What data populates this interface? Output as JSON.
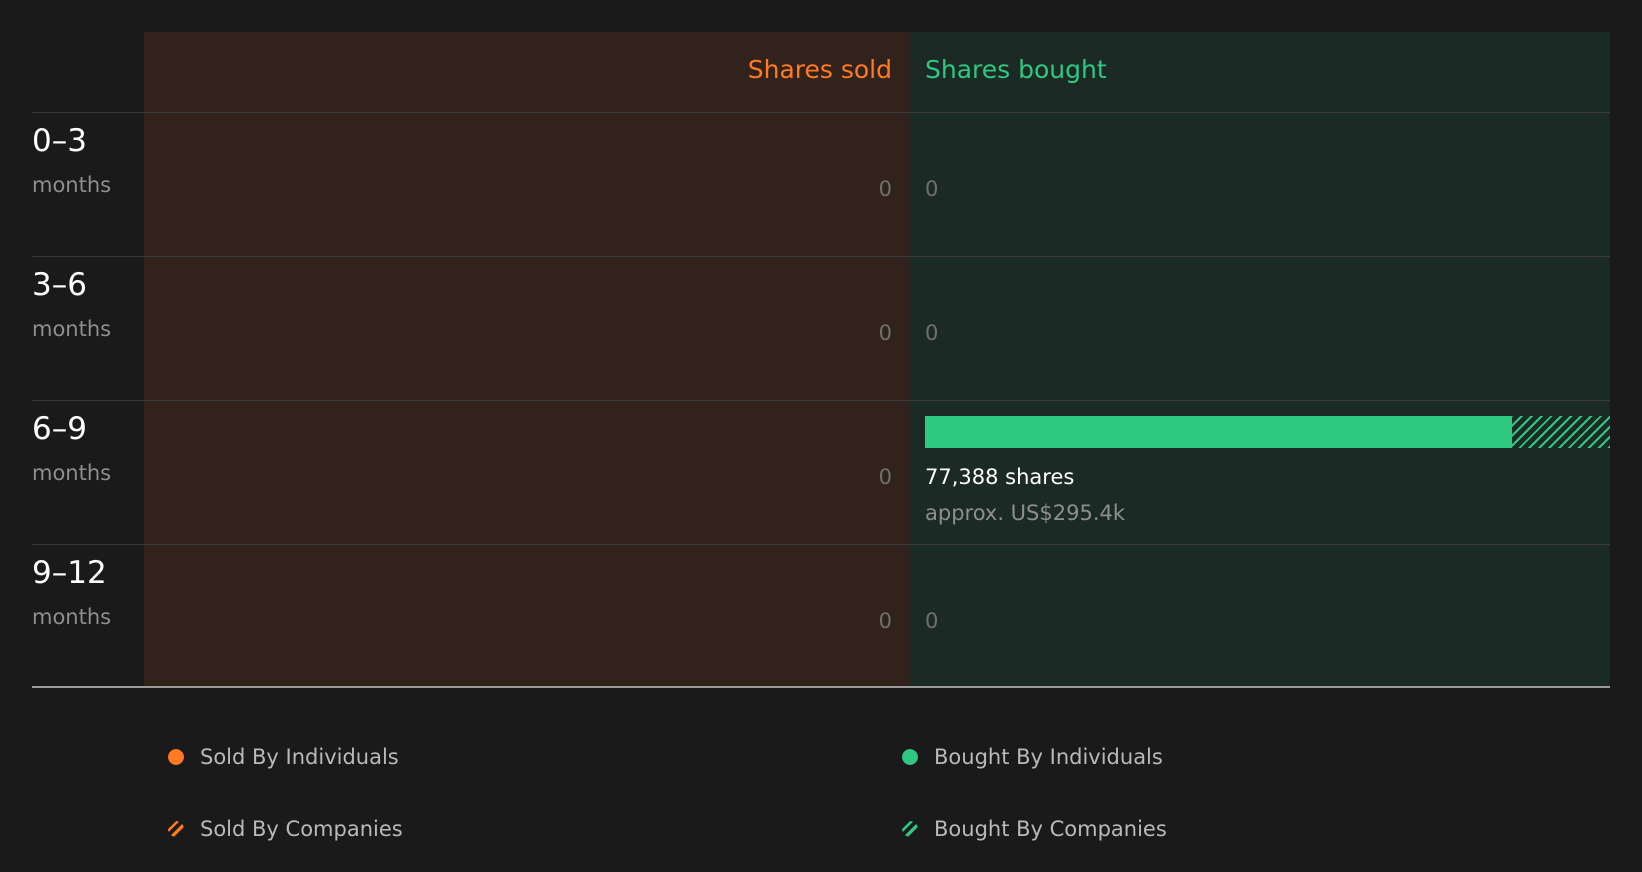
{
  "colors": {
    "sold": "#ff7a22",
    "bought": "#2ec880",
    "sold_panel": "#31231c",
    "bought_panel": "#1b2a24"
  },
  "chart_data": {
    "type": "bar",
    "orientation": "horizontal-diverging",
    "column_headers": {
      "sold": "Shares sold",
      "bought": "Shares bought"
    },
    "categories": [
      {
        "range": "0–3",
        "unit": "months"
      },
      {
        "range": "3–6",
        "unit": "months"
      },
      {
        "range": "6–9",
        "unit": "months"
      },
      {
        "range": "9–12",
        "unit": "months"
      }
    ],
    "series": [
      {
        "name": "Sold By Individuals",
        "side": "sold",
        "pattern": "solid",
        "values": [
          0,
          0,
          0,
          0
        ]
      },
      {
        "name": "Sold By Companies",
        "side": "sold",
        "pattern": "hatched",
        "values": [
          0,
          0,
          0,
          0
        ]
      },
      {
        "name": "Bought By Individuals",
        "side": "bought",
        "pattern": "solid",
        "values": [
          0,
          0,
          66300,
          0
        ]
      },
      {
        "name": "Bought By Companies",
        "side": "bought",
        "pattern": "hatched",
        "values": [
          0,
          0,
          11088,
          0
        ]
      }
    ],
    "row_labels": {
      "sold": [
        "0",
        "0",
        "0",
        "0"
      ],
      "bought": [
        "0",
        "0",
        null,
        "0"
      ]
    },
    "totals": {
      "bought_6_9_shares": "77,388 shares",
      "bought_6_9_value": "approx. US$295.4k"
    },
    "legend": [
      {
        "label": "Sold By Individuals",
        "pattern": "solid",
        "color": "#ff7a22"
      },
      {
        "label": "Bought By Individuals",
        "pattern": "solid",
        "color": "#2ec880"
      },
      {
        "label": "Sold By Companies",
        "pattern": "hatched",
        "color": "#ff7a22"
      },
      {
        "label": "Bought By Companies",
        "pattern": "hatched",
        "color": "#2ec880"
      }
    ],
    "legend_placement": "bottom",
    "grid": true
  }
}
